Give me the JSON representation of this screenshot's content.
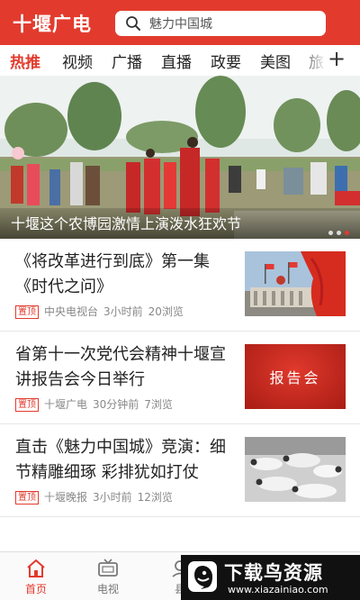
{
  "header": {
    "app_title": "十堰广电",
    "search_placeholder": "魅力中国城",
    "icon": "search-icon"
  },
  "tabs": [
    {
      "label": "热推",
      "active": true
    },
    {
      "label": "视频",
      "active": false
    },
    {
      "label": "广播",
      "active": false
    },
    {
      "label": "直播",
      "active": false
    },
    {
      "label": "政要",
      "active": false
    },
    {
      "label": "美图",
      "active": false
    },
    {
      "label": "旅",
      "active": false
    }
  ],
  "tabs_add_label": "+",
  "banner": {
    "caption": "十堰这个农博园激情上演泼水狂欢节",
    "slide_count": 3,
    "active_slide": 3
  },
  "news": [
    {
      "title": "《将改革进行到底》第一集《时代之问》",
      "tag": "置顶",
      "source": "中央电视台",
      "time": "3小时前",
      "views": "20浏览"
    },
    {
      "title": "省第十一次党代会精神十堰宣讲报告会今日举行",
      "tag": "置顶",
      "source": "十堰广电",
      "time": "30分钟前",
      "views": "7浏览",
      "thumb_text": "报告会"
    },
    {
      "title": "直击《魅力中国城》竞演：细节精雕细琢 彩排犹如打仗",
      "tag": "置顶",
      "source": "十堰晚报",
      "time": "3小时前",
      "views": "12浏览"
    }
  ],
  "bottom_nav": [
    {
      "label": "首页",
      "icon": "home-icon",
      "active": true
    },
    {
      "label": "电视",
      "icon": "tv-icon",
      "active": false
    },
    {
      "label": "县",
      "icon": "county-icon",
      "active": false
    }
  ],
  "watermark": {
    "title": "下载鸟资源",
    "url": "www.xiazainiao.com"
  },
  "colors": {
    "brand_red": "#e23b2e",
    "text": "#222222",
    "meta": "#888888"
  }
}
